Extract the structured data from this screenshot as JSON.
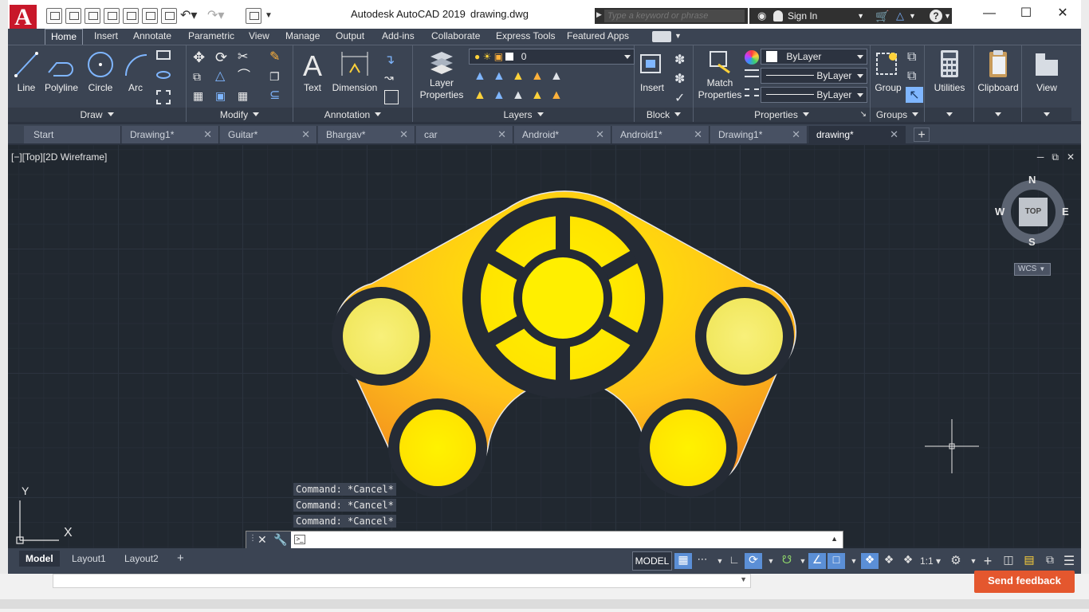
{
  "titlebar": {
    "app_title": "Autodesk AutoCAD 2019",
    "file_name": "drawing.dwg",
    "search_placeholder": "Type a keyword or phrase",
    "sign_in": "Sign In",
    "window_minimize": "—",
    "window_maximize": "☐",
    "window_close": "✕"
  },
  "ribbon_tabs": [
    "Home",
    "Insert",
    "Annotate",
    "Parametric",
    "View",
    "Manage",
    "Output",
    "Add-ins",
    "Collaborate",
    "Express Tools",
    "Featured Apps"
  ],
  "ribbon": {
    "draw": {
      "title": "Draw",
      "line": "Line",
      "polyline": "Polyline",
      "circle": "Circle",
      "arc": "Arc"
    },
    "modify": {
      "title": "Modify"
    },
    "annotation": {
      "title": "Annotation",
      "text": "Text",
      "dimension": "Dimension"
    },
    "layers": {
      "title": "Layers",
      "layer_properties_1": "Layer",
      "layer_properties_2": "Properties",
      "current_layer": "0"
    },
    "block": {
      "title": "Block",
      "insert": "Insert"
    },
    "properties": {
      "title": "Properties",
      "match_1": "Match",
      "match_2": "Properties",
      "color": "ByLayer",
      "linetype": "ByLayer",
      "lineweight": "ByLayer"
    },
    "groups": {
      "title": "Groups",
      "group": "Group"
    },
    "utilities": {
      "label": "Utilities"
    },
    "clipboard": {
      "label": "Clipboard"
    },
    "view": {
      "label": "View"
    }
  },
  "file_tabs": [
    {
      "label": "Start",
      "active": false,
      "closable": false
    },
    {
      "label": "Drawing1*",
      "active": false,
      "closable": true
    },
    {
      "label": "Guitar*",
      "active": false,
      "closable": true
    },
    {
      "label": "Bhargav*",
      "active": false,
      "closable": true
    },
    {
      "label": "car",
      "active": false,
      "closable": true
    },
    {
      "label": "Android*",
      "active": false,
      "closable": true
    },
    {
      "label": "Android1*",
      "active": false,
      "closable": true
    },
    {
      "label": "Drawing1*",
      "active": false,
      "closable": true
    },
    {
      "label": "drawing*",
      "active": true,
      "closable": true
    }
  ],
  "viewport": {
    "label": "[−][Top][2D Wireframe]",
    "viewcube": {
      "top": "TOP",
      "n": "N",
      "s": "S",
      "e": "E",
      "w": "W",
      "wcs": "WCS"
    },
    "ucs": {
      "x": "X",
      "y": "Y"
    },
    "colors": {
      "orange": "#f7931e",
      "yellow": "#ffd400",
      "light_yellow": "#f4ec6a",
      "dark": "#252b35"
    }
  },
  "command_history": [
    "Command: *Cancel*",
    "Command: *Cancel*",
    "Command: *Cancel*"
  ],
  "command_input": {
    "value": ""
  },
  "layout_tabs": [
    {
      "label": "Model",
      "active": true
    },
    {
      "label": "Layout1",
      "active": false
    },
    {
      "label": "Layout2",
      "active": false
    }
  ],
  "status": {
    "model": "MODEL",
    "scale": "1:1"
  },
  "background": {
    "feedback": "Send feedback"
  }
}
